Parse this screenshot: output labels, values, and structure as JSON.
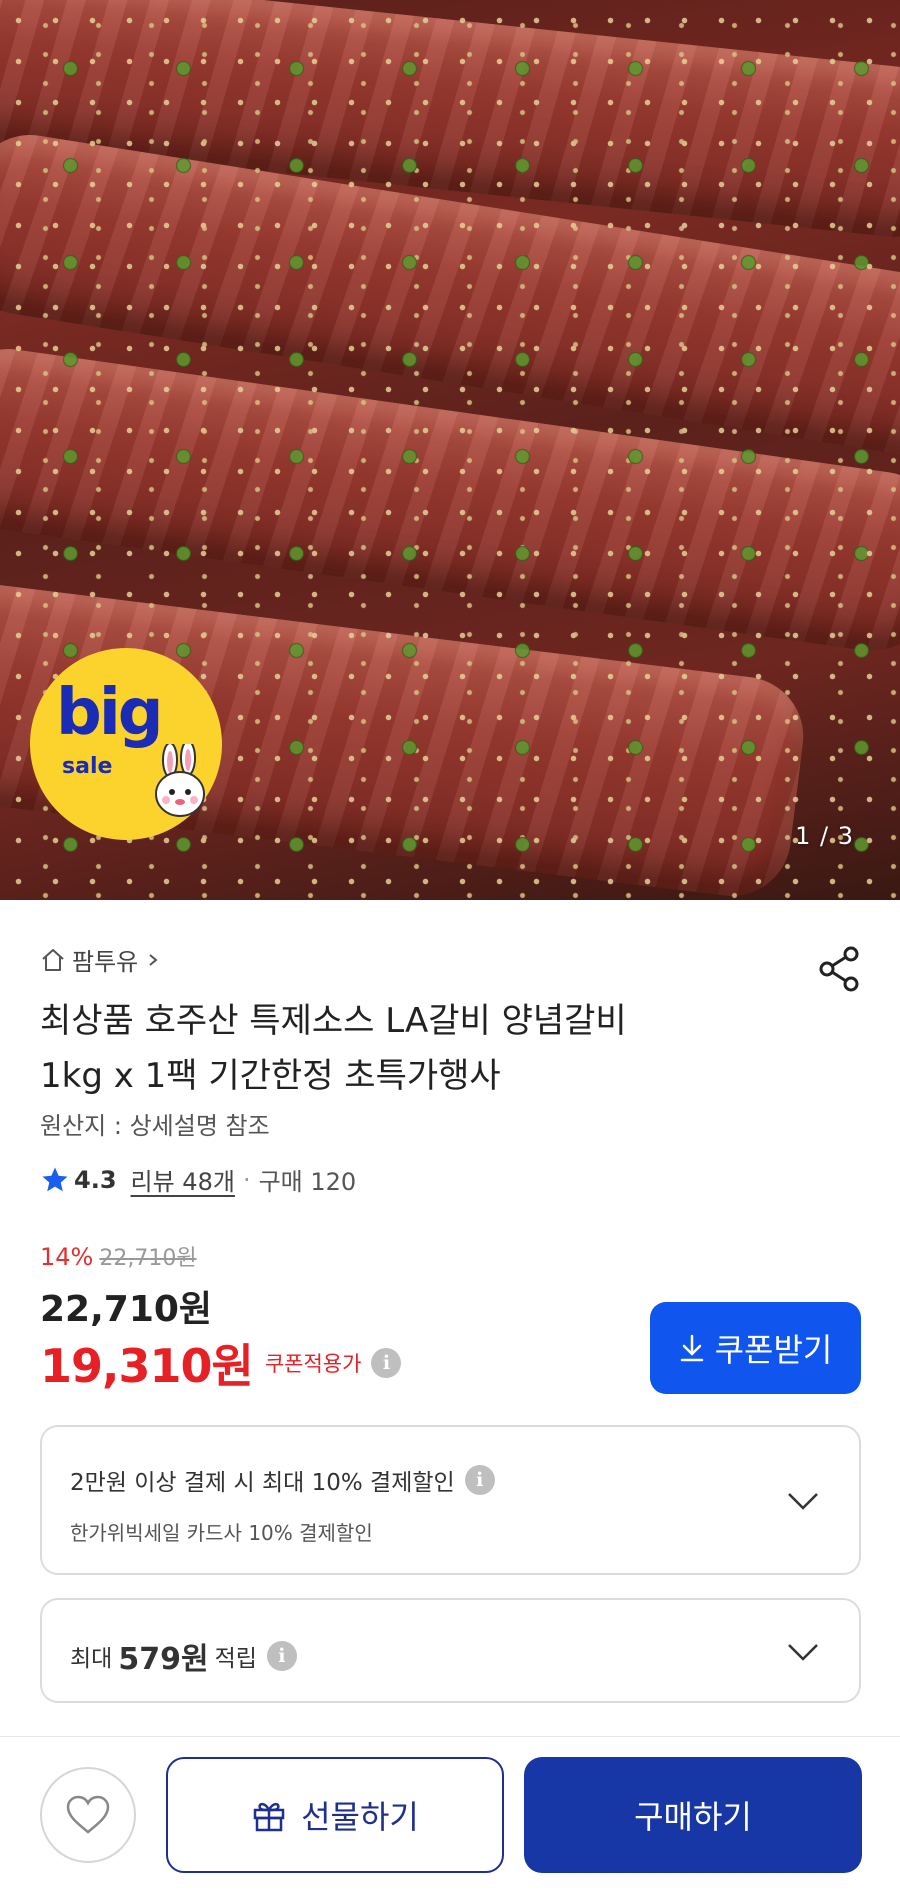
{
  "hero": {
    "image_counter": "1 / 3",
    "badge": {
      "big": "big",
      "sale": "sale"
    }
  },
  "store": {
    "name": "팜투유"
  },
  "product": {
    "title_line1": "최상품 호주산 특제소스 LA갈비 양념갈비",
    "title_line2": "1kg x 1팩 기간한정 초특가행사",
    "origin": "원산지 : 상세설명 참조"
  },
  "rating": {
    "score": "4.3",
    "reviews": "리뷰 48개",
    "separator": "·",
    "purchases": "구매 120"
  },
  "price": {
    "discount_pct": "14%",
    "original": "22,710원",
    "price": "22,710원",
    "sale_price": "19,310원",
    "coupon_label": "쿠폰적용가"
  },
  "coupon_button": {
    "label": "쿠폰받기"
  },
  "payment_card": {
    "main": "2만원 이상 결제 시 최대  10% 결제할인",
    "sub": "한가위빅세일  카드사 10% 결제할인"
  },
  "points_card": {
    "prefix": "최대",
    "amount": "579원",
    "suffix": "적립"
  },
  "bottom_bar": {
    "gift_label": "선물하기",
    "buy_label": "구매하기"
  },
  "colors": {
    "accent_blue": "#0f55ee",
    "buy_navy": "#1837a6",
    "sale_red": "#e62025",
    "star_blue": "#1a5ef0",
    "badge_yellow": "#fcd22d"
  },
  "icons": [
    "home-icon",
    "chevron-right-icon",
    "share-icon",
    "star-icon",
    "info-icon",
    "download-icon",
    "chevron-down-icon",
    "heart-icon",
    "gift-icon"
  ]
}
